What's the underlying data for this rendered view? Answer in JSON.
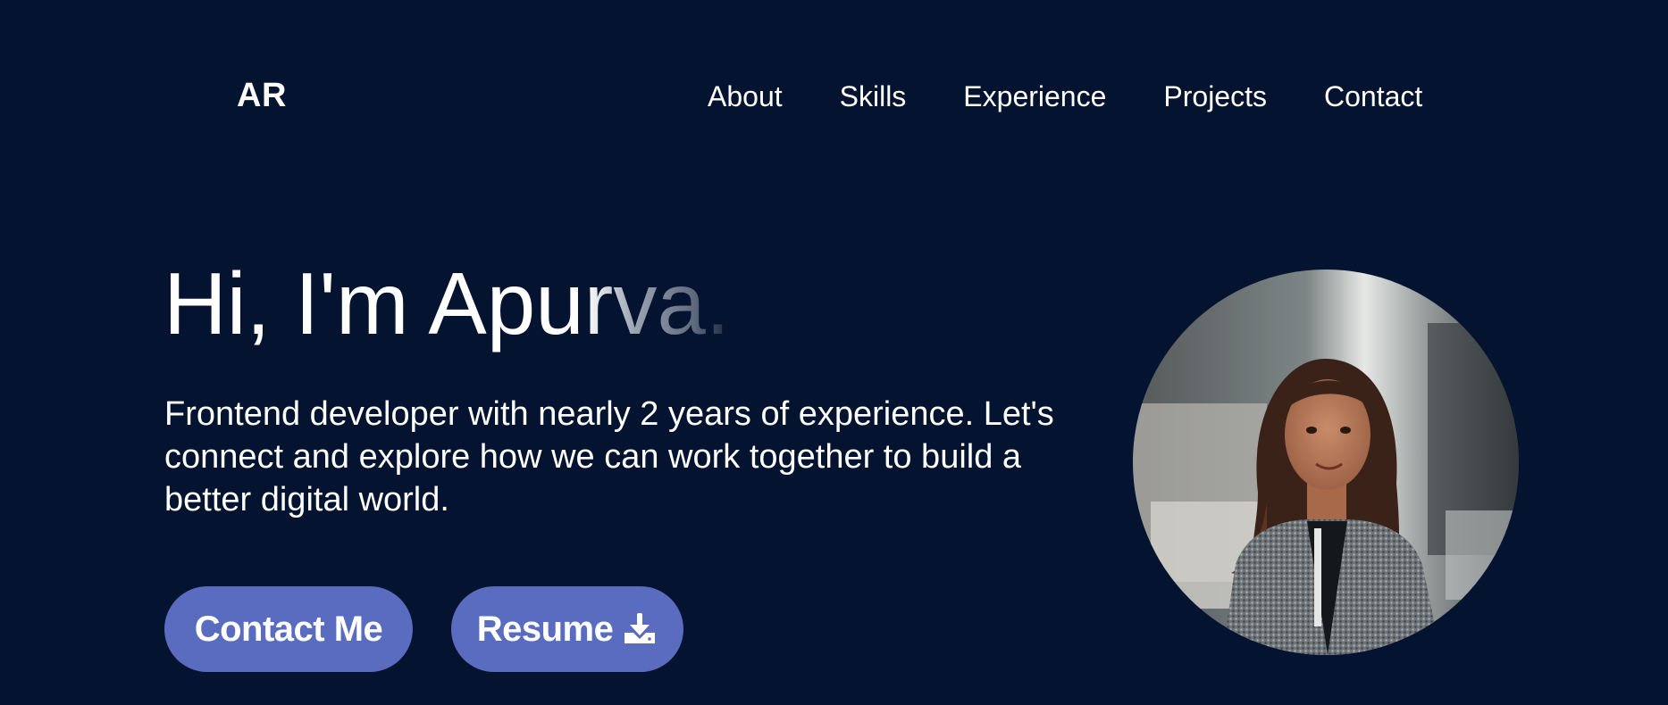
{
  "header": {
    "logo": "AR",
    "nav": [
      {
        "label": "About"
      },
      {
        "label": "Skills"
      },
      {
        "label": "Experience"
      },
      {
        "label": "Projects"
      },
      {
        "label": "Contact"
      }
    ]
  },
  "hero": {
    "title_solid": "Hi, I'm Apu",
    "title_fading": "rva.",
    "subtitle": "Frontend developer with nearly 2 years of experience. Let's connect and explore how we can work together to build a better digital world.",
    "contact_label": "Contact Me",
    "resume_label": "Resume",
    "resume_icon": "download-icon"
  },
  "colors": {
    "background": "#04132f",
    "button": "#5a6cc0",
    "text": "#ffffff"
  }
}
